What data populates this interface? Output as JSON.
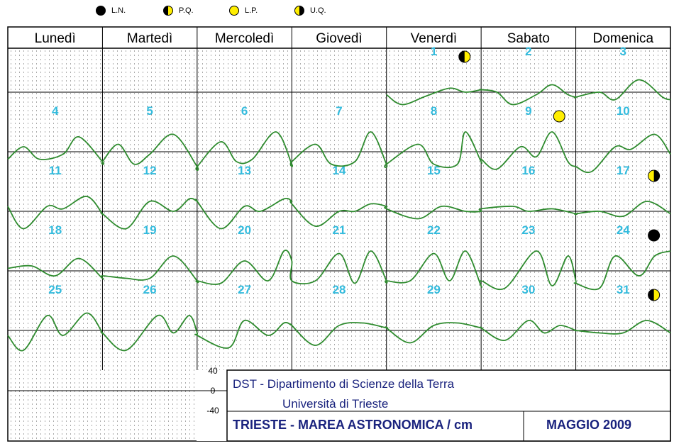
{
  "legend": [
    {
      "symbol": "new-moon",
      "label": "L.N."
    },
    {
      "symbol": "first-quarter",
      "label": "P.Q."
    },
    {
      "symbol": "full-moon",
      "label": "L.P."
    },
    {
      "symbol": "last-quarter",
      "label": "U.Q."
    }
  ],
  "days": [
    "Lunedì",
    "Martedì",
    "Mercoledì",
    "Giovedì",
    "Venerdì",
    "Sabato",
    "Domenica"
  ],
  "colors": {
    "curve": "#2e8b2e",
    "date": "#33bbdd",
    "dots": "#555555",
    "frame": "#000000",
    "full_moon": "#ffee00",
    "new_moon": "#000000",
    "title": "#1a237e"
  },
  "chart_data": {
    "type": "line",
    "title": "TRIESTE - MAREA ASTRONOMICA / cm",
    "month": "MAGGIO 2009",
    "ylabel": "cm",
    "ylim": [
      -40,
      40
    ],
    "y_ticks": [
      "40",
      "0",
      "-40"
    ],
    "x_unit": "giorno (0-24 h)",
    "weeks": [
      {
        "dates": [
          null,
          null,
          null,
          null,
          1,
          2,
          3
        ],
        "series": [
          null,
          null,
          null,
          null,
          [
            [
              0,
              -5
            ],
            [
              4,
              -25
            ],
            [
              10,
              -8
            ],
            [
              16,
              8
            ],
            [
              20,
              0
            ],
            [
              24,
              5
            ]
          ],
          [
            [
              0,
              5
            ],
            [
              4,
              0
            ],
            [
              8,
              -25
            ],
            [
              14,
              -5
            ],
            [
              18,
              15
            ],
            [
              22,
              -5
            ],
            [
              24,
              -10
            ]
          ],
          [
            [
              0,
              -10
            ],
            [
              6,
              0
            ],
            [
              10,
              -15
            ],
            [
              16,
              25
            ],
            [
              22,
              -10
            ],
            [
              24,
              -15
            ]
          ]
        ]
      },
      {
        "dates": [
          4,
          5,
          6,
          7,
          8,
          9,
          10
        ],
        "series": [
          [
            [
              0,
              -15
            ],
            [
              4,
              10
            ],
            [
              8,
              -15
            ],
            [
              14,
              -5
            ],
            [
              18,
              30
            ],
            [
              24,
              -20
            ]
          ],
          [
            [
              0,
              -20
            ],
            [
              4,
              15
            ],
            [
              8,
              -25
            ],
            [
              12,
              -5
            ],
            [
              18,
              35
            ],
            [
              24,
              -30
            ]
          ],
          [
            [
              0,
              -30
            ],
            [
              6,
              20
            ],
            [
              10,
              -20
            ],
            [
              14,
              -15
            ],
            [
              20,
              40
            ],
            [
              24,
              -25
            ]
          ],
          [
            [
              0,
              -20
            ],
            [
              6,
              15
            ],
            [
              10,
              -25
            ],
            [
              16,
              -20
            ],
            [
              20,
              40
            ],
            [
              24,
              -25
            ]
          ],
          [
            [
              0,
              -25
            ],
            [
              8,
              15
            ],
            [
              12,
              -25
            ],
            [
              18,
              -25
            ],
            [
              20,
              40
            ],
            [
              24,
              -20
            ]
          ],
          [
            [
              0,
              -15
            ],
            [
              4,
              -35
            ],
            [
              10,
              10
            ],
            [
              14,
              -10
            ],
            [
              18,
              40
            ],
            [
              22,
              -20
            ],
            [
              24,
              -30
            ]
          ],
          [
            [
              0,
              -30
            ],
            [
              4,
              -40
            ],
            [
              10,
              10
            ],
            [
              14,
              5
            ],
            [
              20,
              35
            ],
            [
              24,
              -5
            ]
          ]
        ]
      },
      {
        "dates": [
          11,
          12,
          13,
          14,
          15,
          16,
          17
        ],
        "series": [
          [
            [
              0,
              10
            ],
            [
              4,
              -35
            ],
            [
              10,
              10
            ],
            [
              14,
              5
            ],
            [
              20,
              30
            ],
            [
              24,
              -5
            ]
          ],
          [
            [
              0,
              -5
            ],
            [
              6,
              -35
            ],
            [
              12,
              20
            ],
            [
              18,
              0
            ],
            [
              22,
              25
            ],
            [
              24,
              20
            ]
          ],
          [
            [
              0,
              20
            ],
            [
              6,
              -35
            ],
            [
              12,
              10
            ],
            [
              16,
              0
            ],
            [
              22,
              25
            ],
            [
              24,
              20
            ]
          ],
          [
            [
              0,
              15
            ],
            [
              6,
              -30
            ],
            [
              12,
              0
            ],
            [
              16,
              0
            ],
            [
              20,
              15
            ],
            [
              24,
              10
            ]
          ],
          [
            [
              0,
              5
            ],
            [
              8,
              -15
            ],
            [
              14,
              10
            ],
            [
              20,
              0
            ],
            [
              24,
              0
            ]
          ],
          [
            [
              0,
              5
            ],
            [
              8,
              10
            ],
            [
              12,
              0
            ],
            [
              18,
              5
            ],
            [
              24,
              -5
            ]
          ],
          [
            [
              0,
              -5
            ],
            [
              6,
              0
            ],
            [
              12,
              -10
            ],
            [
              18,
              20
            ],
            [
              24,
              -5
            ]
          ]
        ]
      },
      {
        "dates": [
          18,
          19,
          20,
          21,
          22,
          23,
          24
        ],
        "series": [
          [
            [
              0,
              5
            ],
            [
              6,
              10
            ],
            [
              12,
              -10
            ],
            [
              18,
              25
            ],
            [
              24,
              -15
            ]
          ],
          [
            [
              0,
              -10
            ],
            [
              6,
              -15
            ],
            [
              12,
              -15
            ],
            [
              18,
              30
            ],
            [
              24,
              -20
            ]
          ],
          [
            [
              0,
              -20
            ],
            [
              6,
              -25
            ],
            [
              12,
              20
            ],
            [
              18,
              -20
            ],
            [
              22,
              40
            ],
            [
              24,
              20
            ]
          ],
          [
            [
              0,
              -20
            ],
            [
              6,
              -20
            ],
            [
              12,
              35
            ],
            [
              16,
              -25
            ],
            [
              20,
              40
            ],
            [
              24,
              -20
            ]
          ],
          [
            [
              0,
              -20
            ],
            [
              6,
              -20
            ],
            [
              12,
              35
            ],
            [
              16,
              -20
            ],
            [
              20,
              40
            ],
            [
              24,
              -30
            ]
          ],
          [
            [
              0,
              -20
            ],
            [
              6,
              -35
            ],
            [
              14,
              40
            ],
            [
              18,
              -30
            ],
            [
              22,
              30
            ],
            [
              24,
              -20
            ]
          ],
          [
            [
              0,
              -25
            ],
            [
              6,
              -35
            ],
            [
              10,
              30
            ],
            [
              16,
              -10
            ],
            [
              20,
              30
            ],
            [
              24,
              40
            ]
          ]
        ]
      },
      {
        "dates": [
          25,
          26,
          27,
          28,
          29,
          30,
          31
        ],
        "series": [
          [
            [
              0,
              -10
            ],
            [
              4,
              -40
            ],
            [
              10,
              30
            ],
            [
              14,
              -10
            ],
            [
              20,
              35
            ],
            [
              24,
              -5
            ]
          ],
          [
            [
              0,
              -5
            ],
            [
              6,
              -40
            ],
            [
              14,
              30
            ],
            [
              18,
              -5
            ],
            [
              22,
              30
            ],
            [
              24,
              -5
            ]
          ],
          [
            [
              0,
              -10
            ],
            [
              8,
              -35
            ],
            [
              12,
              20
            ],
            [
              18,
              -10
            ],
            [
              22,
              15
            ],
            [
              24,
              10
            ]
          ],
          [
            [
              0,
              10
            ],
            [
              6,
              -30
            ],
            [
              12,
              10
            ],
            [
              18,
              15
            ],
            [
              24,
              5
            ]
          ],
          [
            [
              0,
              5
            ],
            [
              6,
              -25
            ],
            [
              12,
              10
            ],
            [
              18,
              15
            ],
            [
              24,
              5
            ]
          ],
          [
            [
              0,
              5
            ],
            [
              6,
              -20
            ],
            [
              12,
              20
            ],
            [
              16,
              -5
            ],
            [
              20,
              10
            ],
            [
              24,
              0
            ]
          ],
          [
            [
              0,
              0
            ],
            [
              6,
              -5
            ],
            [
              12,
              -5
            ],
            [
              18,
              20
            ],
            [
              24,
              -5
            ]
          ]
        ]
      }
    ],
    "moon_phases": [
      {
        "date": 1,
        "phase": "first-quarter"
      },
      {
        "date": 9,
        "phase": "full-moon"
      },
      {
        "date": 17,
        "phase": "last-quarter"
      },
      {
        "date": 24,
        "phase": "new-moon"
      },
      {
        "date": 31,
        "phase": "first-quarter"
      }
    ]
  },
  "footer": {
    "line1": "DST  -  Dipartimento  di  Scienze  della  Terra",
    "line2": "Università  di  Trieste",
    "title": "TRIESTE - MAREA ASTRONOMICA / cm",
    "month": "MAGGIO  2009"
  }
}
